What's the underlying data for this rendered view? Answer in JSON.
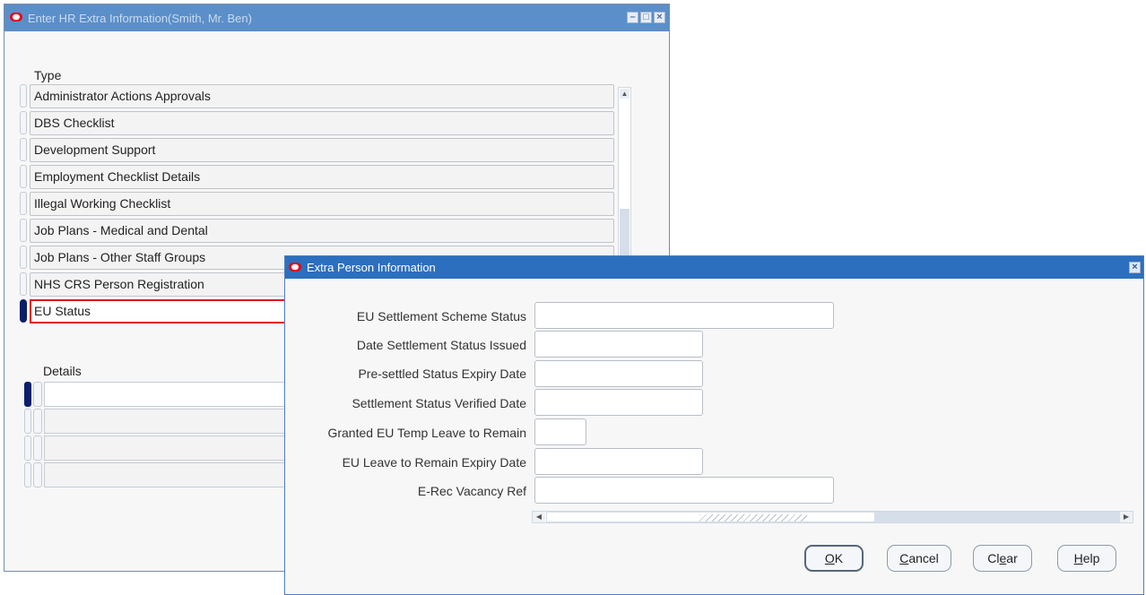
{
  "main_window": {
    "title": "Enter HR Extra Information(Smith, Mr. Ben)",
    "type_header": "Type",
    "details_header": "Details",
    "types": [
      {
        "label": "Administrator Actions Approvals"
      },
      {
        "label": "DBS Checklist"
      },
      {
        "label": "Development Support"
      },
      {
        "label": "Employment Checklist Details"
      },
      {
        "label": "Illegal Working Checklist"
      },
      {
        "label": "Job Plans - Medical and Dental"
      },
      {
        "label": "Job Plans - Other Staff Groups"
      },
      {
        "label": "NHS CRS Person Registration"
      },
      {
        "label": "EU Status",
        "selected": true
      }
    ]
  },
  "dialog": {
    "title": "Extra Person Information",
    "fields": [
      {
        "label": "EU Settlement Scheme Status",
        "value": ""
      },
      {
        "label": "Date Settlement Status Issued",
        "value": ""
      },
      {
        "label": "Pre-settled Status Expiry Date",
        "value": ""
      },
      {
        "label": "Settlement Status Verified Date",
        "value": ""
      },
      {
        "label": "Granted EU Temp Leave to Remain",
        "value": ""
      },
      {
        "label": "EU Leave to Remain Expiry Date",
        "value": ""
      },
      {
        "label": "E-Rec Vacancy Ref",
        "value": ""
      }
    ],
    "buttons": {
      "ok": {
        "mnemonic": "O",
        "rest": "K"
      },
      "cancel": {
        "mnemonic": "C",
        "rest": "ancel"
      },
      "clear": {
        "pre": "Cl",
        "mnemonic": "e",
        "rest": "ar"
      },
      "help": {
        "mnemonic": "H",
        "rest": "elp"
      }
    }
  },
  "colors": {
    "inactive_titlebar": "#5b8fc9",
    "active_titlebar": "#2c6fbe",
    "selection_outline": "#e0141e",
    "record_indicator": "#0a1f6a"
  }
}
